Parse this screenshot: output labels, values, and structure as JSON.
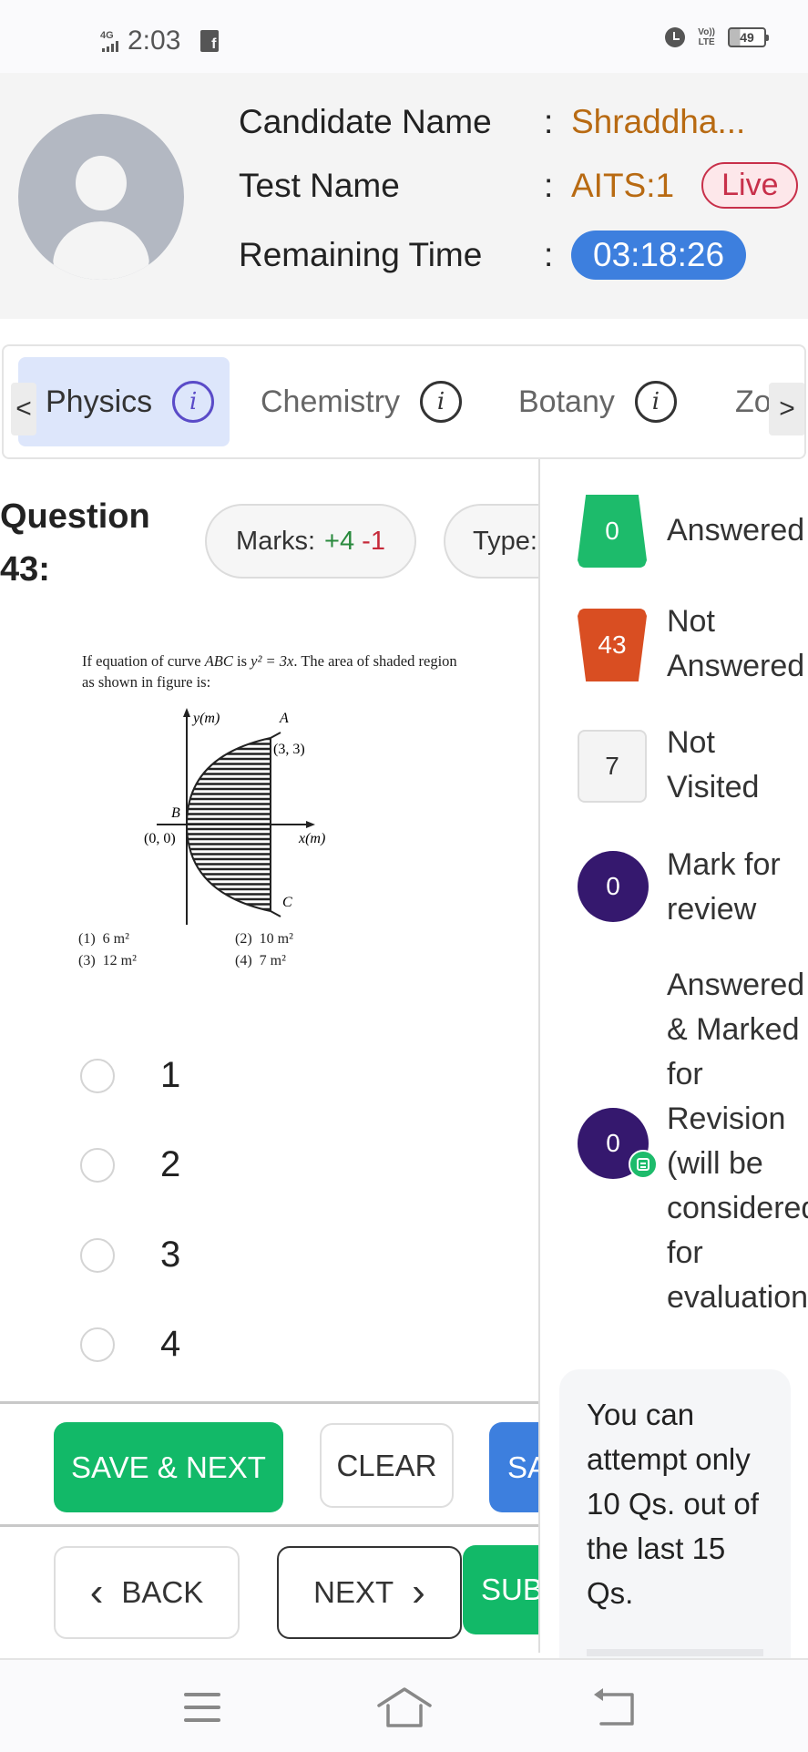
{
  "status_bar": {
    "network": "4G",
    "time": "2:03",
    "volte_top": "Vo))",
    "volte_bottom": "LTE",
    "battery": "49",
    "icons": [
      "signal-icon",
      "facebook-notification-icon",
      "alarm-icon",
      "volte-icon",
      "battery-icon"
    ]
  },
  "header": {
    "candidate_label": "Candidate Name",
    "candidate_value": "Shraddha...",
    "test_label": "Test Name",
    "test_value": "AITS:1",
    "live_badge": "Live",
    "time_label": "Remaining Time",
    "time_value": "03:18:26",
    "colon": ":"
  },
  "tabs": {
    "prev_arrow": "<",
    "next_arrow": ">",
    "items": [
      {
        "label": "Physics",
        "active": true
      },
      {
        "label": "Chemistry",
        "active": false
      },
      {
        "label": "Botany",
        "active": false
      },
      {
        "label": "Zo",
        "active": false
      }
    ],
    "info_glyph": "i"
  },
  "question": {
    "title_line1": "Question",
    "title_line2": "43:",
    "marks_label": "Marks:",
    "marks_positive": "+4",
    "marks_negative": "-1",
    "type_label": "Type:",
    "text_part1": "If equation of curve ",
    "text_curve": "ABC",
    "text_part2": " is ",
    "text_eq": "y² = 3x",
    "text_part3": ". The area of shaded region as shown in figure is:",
    "figure": {
      "y_axis_label": "y(m)",
      "x_axis_label": "x(m)",
      "point_a": "A",
      "point_b": "B",
      "point_c": "C",
      "point_a_coords": "(3, 3)",
      "origin_coords": "(0, 0)"
    },
    "printed_options": [
      {
        "num": "(1)",
        "value": "6 m²"
      },
      {
        "num": "(2)",
        "value": "10 m²"
      },
      {
        "num": "(3)",
        "value": "12 m²"
      },
      {
        "num": "(4)",
        "value": "7 m²"
      }
    ],
    "answer_options": [
      "1",
      "2",
      "3",
      "4"
    ],
    "selected_option": null
  },
  "actions": {
    "save_next": "SAVE & NEXT",
    "clear": "CLEAR",
    "save_mark": "SA",
    "back": "BACK",
    "back_chevron": "‹",
    "next": "NEXT",
    "next_chevron": "›",
    "submit": "SUB"
  },
  "legend": [
    {
      "count": "0",
      "label": "Answered",
      "color": "#1dbb6b"
    },
    {
      "count": "43",
      "label": "Not\nAnswered",
      "color": "#d94e22"
    },
    {
      "count": "7",
      "label": "Not\nVisited",
      "color": "#f4f4f4"
    },
    {
      "count": "0",
      "label": "Mark for\nreview",
      "color": "#35186e"
    },
    {
      "count": "0",
      "label": "Answered\n& Marked\nfor\nRevision\n(will be\nconsidered\nfor\nevaluation",
      "color": "#35186e"
    }
  ],
  "note": "You can attempt only 10 Qs. out of the last 15 Qs.",
  "nav_bar": {
    "icons": [
      "recent-apps-icon",
      "home-icon",
      "back-icon"
    ]
  },
  "colors": {
    "accent_blue": "#3d7fde",
    "green": "#12b968",
    "orange_value": "#b86a12",
    "live_red": "#c8304a",
    "active_tab_bg": "#dde6fb"
  }
}
